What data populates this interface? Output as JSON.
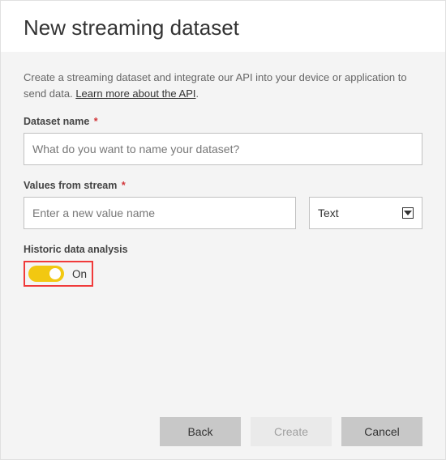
{
  "header": {
    "title": "New streaming dataset"
  },
  "intro": {
    "text": "Create a streaming dataset and integrate our API into your device or application to send data. ",
    "link_text": "Learn more about the API",
    "suffix": "."
  },
  "dataset_name": {
    "label": "Dataset name",
    "required_mark": "*",
    "placeholder": "What do you want to name your dataset?",
    "value": ""
  },
  "values_stream": {
    "label": "Values from stream",
    "required_mark": "*",
    "input_placeholder": "Enter a new value name",
    "input_value": "",
    "type_selected": "Text"
  },
  "historic": {
    "label": "Historic data analysis",
    "state_label": "On",
    "enabled": true
  },
  "buttons": {
    "back": "Back",
    "create": "Create",
    "cancel": "Cancel"
  }
}
